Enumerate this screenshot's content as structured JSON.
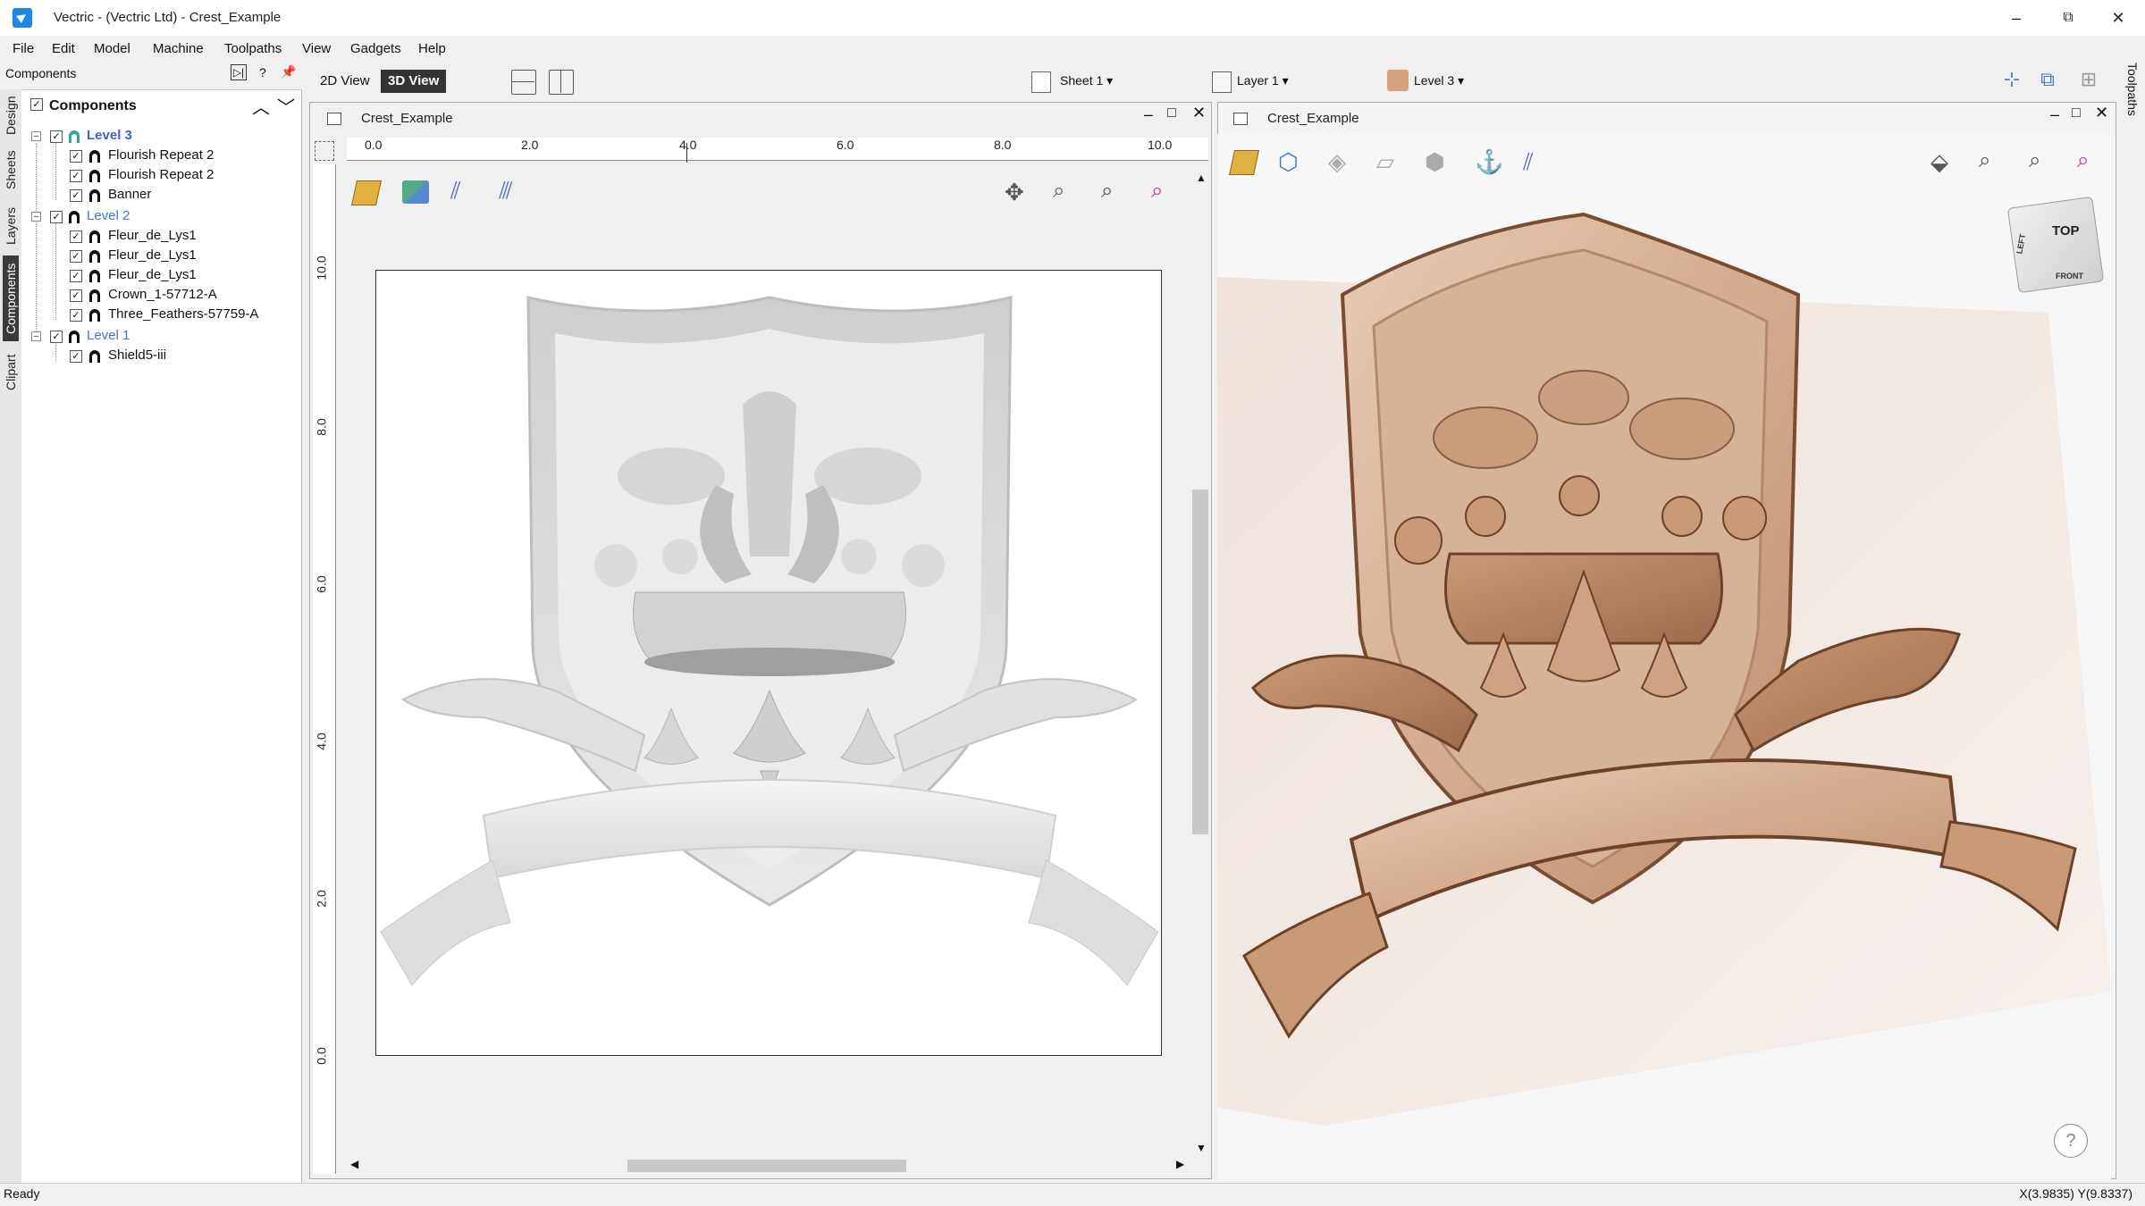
{
  "window": {
    "title": "Vectric - (Vectric Ltd) - Crest_Example",
    "minimize": "–",
    "restore": "⧉",
    "close": "✕"
  },
  "menu": [
    "File",
    "Edit",
    "Model",
    "Machine",
    "Toolpaths",
    "View",
    "Gadgets",
    "Help"
  ],
  "panel": {
    "title": "Components",
    "help": "?",
    "root_label": "Components",
    "side_tabs": [
      "Design",
      "Sheets",
      "Layers",
      "Components",
      "Clipart"
    ],
    "tree": [
      {
        "label": "Level 3",
        "kind": "level",
        "active": true,
        "children": [
          "Flourish Repeat 2",
          "Flourish Repeat 2",
          "Banner"
        ]
      },
      {
        "label": "Level 2",
        "kind": "level",
        "active": false,
        "children": [
          "Fleur_de_Lys1",
          "Fleur_de_Lys1",
          "Fleur_de_Lys1",
          "Crown_1-57712-A",
          "Three_Feathers-57759-A"
        ]
      },
      {
        "label": "Level 1",
        "kind": "level",
        "active": false,
        "children": [
          "Shield5-iii"
        ]
      }
    ]
  },
  "toolbar": {
    "view_2d": "2D View",
    "view_3d": "3D View",
    "sheet": "Sheet 1",
    "layer": "Layer 1",
    "level": "Level 3",
    "right_tab": "Toolpaths"
  },
  "view2d": {
    "doc_title": "Crest_Example",
    "ruler_h": [
      "0.0",
      "2.0",
      "4.0",
      "6.0",
      "8.0",
      "10.0"
    ],
    "ruler_v": [
      "10.0",
      "8.0",
      "6.0",
      "4.0",
      "2.0",
      "0.0"
    ]
  },
  "view3d": {
    "doc_title": "Crest_Example",
    "cube_top": "TOP",
    "cube_front": "FRONT",
    "cube_left": "LEFT",
    "help": "?"
  },
  "status": {
    "text": "Ready",
    "coords": "X(3.9835) Y(9.8337)"
  },
  "colors": {
    "accent": "#3c5fd0",
    "wood": "#d9b79c"
  }
}
